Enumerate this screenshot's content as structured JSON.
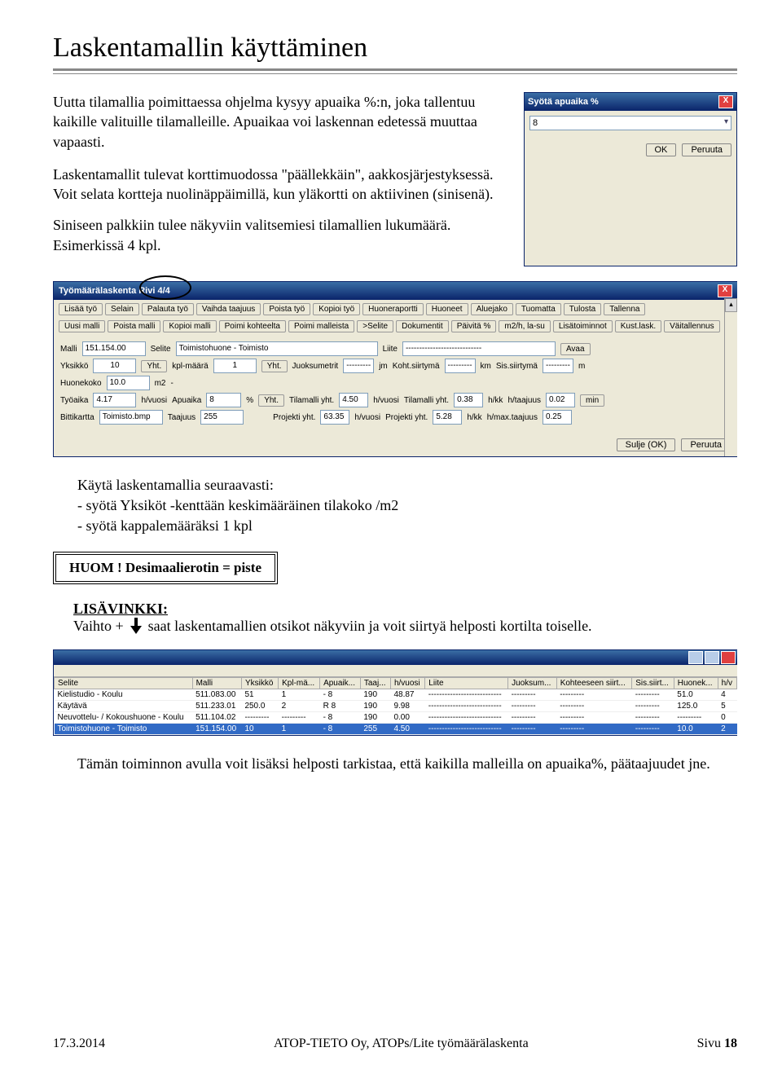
{
  "heading": "Laskentamallin käyttäminen",
  "intro_p1": "Uutta tilamallia poimittaessa ohjelma kysyy apuaika %:n, joka tallentuu kaikille valituille tilamalleille. Apuaikaa voi laskennan edetessä muuttaa vapaasti.",
  "intro_p2": "Laskentamallit tulevat korttimuodossa \"päällekkäin\", aakkosjärjestyksessä. Voit selata kortteja nuolinäppäimillä, kun yläkortti on aktiivinen (sinisenä).",
  "intro_p3": "Siniseen palkkiin tulee näkyviin valitsemiesi tilamallien lukumäärä. Esimerkissä 4 kpl.",
  "dlg": {
    "title": "Syötä apuaika %",
    "value": "8",
    "ok": "OK",
    "cancel": "Peruuta"
  },
  "win": {
    "title": "Työmäärälaskenta   Rivi 4/4",
    "row1": [
      "Lisää työ",
      "Selain",
      "Palauta työ",
      "Vaihda taajuus",
      "Poista työ",
      "Kopioi työ",
      "Huoneraportti",
      "Huoneet",
      "Aluejako",
      "Tuomatta",
      "Tulosta",
      "Tallenna"
    ],
    "row2": [
      "Uusi malli",
      "Poista malli",
      "Kopioi malli",
      "Poimi kohteelta",
      "Poimi malleista",
      ">Selite",
      "Dokumentit",
      "Päivitä %",
      "m2/h, la-su",
      "Lisätoiminnot",
      "Kust.lask.",
      "Väitallennus"
    ],
    "fields": {
      "Malli": "151.154.00",
      "Selite": "Toimistohuone - Toimisto",
      "Liite": "----------------------------",
      "Avaa": "Avaa",
      "Yksikko": "10",
      "Yht1": "Yht.",
      "kplmaara_l": "kpl-määrä",
      "kplmaara": "1",
      "Yht2": "Yht.",
      "Juoksumetrit_l": "Juoksumetrit",
      "Juoksumetrit": "---------",
      "jm": "jm",
      "Kohtsiirtyma_l": "Koht.siirtymä",
      "Kohtsiirtyma": "---------",
      "km": "km",
      "Sissiirtyma_l": "Sis.siirtymä",
      "Sissiirtyma": "---------",
      "m": "m",
      "Huonekoko_l": "Huonekoko",
      "Huonekoko": "10.0",
      "m2": "m2",
      "dash": "-",
      "Tyoaika_l": "Työaika",
      "Tyoaika": "4.17",
      "hvuosi1": "h/vuosi",
      "Apuaika_l": "Apuaika",
      "Apuaika": "8",
      "pct": "%",
      "Yht3": "Yht.",
      "Tilamalliyht_l": "Tilamalli yht.",
      "Tilamalliyht": "4.50",
      "hvuosi2": "h/vuosi",
      "Tilamalliyht2_l": "Tilamalli yht.",
      "Tilamalliyht2": "0.38",
      "hkk1": "h/kk",
      "htaajuus_l": "h/taajuus",
      "htaajuus": "0.02",
      "min": "min",
      "Bittikartta_l": "Bittikartta",
      "Bittikartta": "Toimisto.bmp",
      "Taajuus_l": "Taajuus",
      "Taajuus": "255",
      "Projektiyht_l": "Projekti yht.",
      "Projektiyht": "63.35",
      "hvuosi3": "h/vuosi",
      "Projektiyht2_l": "Projekti yht.",
      "Projektiyht2": "5.28",
      "hkk2": "h/kk",
      "hmaxtaajuus_l": "h/max.taajuus",
      "hmaxtaajuus": "0.25"
    },
    "footer_ok": "Sulje (OK)",
    "footer_cancel": "Peruuta"
  },
  "usage_head": "Käytä laskentamallia seuraavasti:",
  "usage_l1": "- syötä Yksiköt -kenttään keskimääräinen tilakoko /m2",
  "usage_l2": "- syötä kappalemääräksi 1 kpl",
  "huom": "HUOM ! Desimaalierotin = piste",
  "lisav_head": "LISÄVINKKI:",
  "lisav_pre": "Vaihto +",
  "lisav_post": "saat laskentamallien otsikot näkyviin ja voit siirtyä helposti kortilta toiselle.",
  "list": {
    "headers": [
      "Selite",
      "Malli",
      "Yksikkö",
      "Kpl-mä...",
      "Apuaik...",
      "Taaj...",
      "h/vuosi",
      "Liite",
      "Juoksum...",
      "Kohteeseen siirt...",
      "Sis.siirt...",
      "Huonek...",
      "h/v"
    ],
    "rows": [
      {
        "c": [
          "Kielistudio - Koulu",
          "511.083.00",
          "51",
          "1",
          "- 8",
          "190",
          "48.87",
          "---------------------------",
          "---------",
          "---------",
          "---------",
          "51.0",
          "4"
        ]
      },
      {
        "c": [
          "Käytävä",
          "511.233.01",
          "250.0",
          "2",
          "R 8",
          "190",
          "9.98",
          "---------------------------",
          "---------",
          "---------",
          "---------",
          "125.0",
          "5"
        ]
      },
      {
        "c": [
          "Neuvottelu- / Kokoushuone - Koulu",
          "511.104.02",
          "---------",
          "---------",
          "- 8",
          "190",
          "0.00",
          "---------------------------",
          "---------",
          "---------",
          "---------",
          "---------",
          "0"
        ]
      },
      {
        "c": [
          "Toimistohuone - Toimisto",
          "151.154.00",
          "10",
          "1",
          "- 8",
          "255",
          "4.50",
          "---------------------------",
          "---------",
          "---------",
          "---------",
          "10.0",
          "2"
        ],
        "sel": true
      }
    ]
  },
  "final": "Tämän toiminnon avulla voit lisäksi helposti tarkistaa, että kaikilla malleilla on apuaika%, päätaajuudet jne.",
  "footer_date": "17.3.2014",
  "footer_mid": "ATOP-TIETO Oy, ATOPs/Lite työmäärälaskenta",
  "footer_page": "Sivu 18"
}
